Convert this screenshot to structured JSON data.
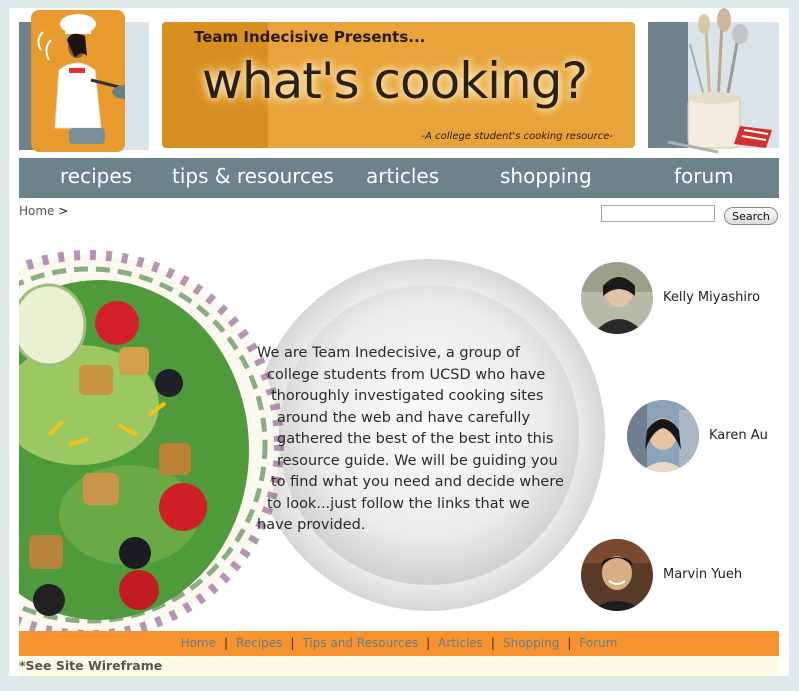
{
  "header": {
    "presents": "Team Indecisive Presents...",
    "title": "what's cooking?",
    "tagline": "-A college student's cooking resource-"
  },
  "nav": {
    "items": [
      "recipes",
      "tips & resources",
      "articles",
      "shopping",
      "forum"
    ]
  },
  "breadcrumb": {
    "home": "Home",
    "separator": ">"
  },
  "search": {
    "placeholder": "",
    "button_label": "Search"
  },
  "intro": {
    "lines": [
      "We are Team Inedecisive, a group of",
      "college students from UCSD who have",
      "thoroughly investigated cooking sites",
      "around the  web and have carefully",
      "gathered the best of the best into this",
      "resource guide. We will be guiding you",
      "to find what you need and decide where",
      "to look...just follow the links that we",
      "have provided."
    ]
  },
  "team": [
    {
      "name": "Kelly Miyashiro"
    },
    {
      "name": "Karen Au"
    },
    {
      "name": "Marvin Yueh"
    }
  ],
  "footer": {
    "links": [
      "Home",
      "Recipes",
      "Tips and Resources",
      "Articles",
      "Shopping",
      "Forum"
    ],
    "separator": "|"
  },
  "note": "*See Site Wireframe",
  "colors": {
    "page_bg": "#dfe9ea",
    "nav_bg": "#6c838c",
    "banner_orange": "#e8a33a",
    "footer_orange": "#f7932f",
    "footer_link": "#6a7d86"
  }
}
